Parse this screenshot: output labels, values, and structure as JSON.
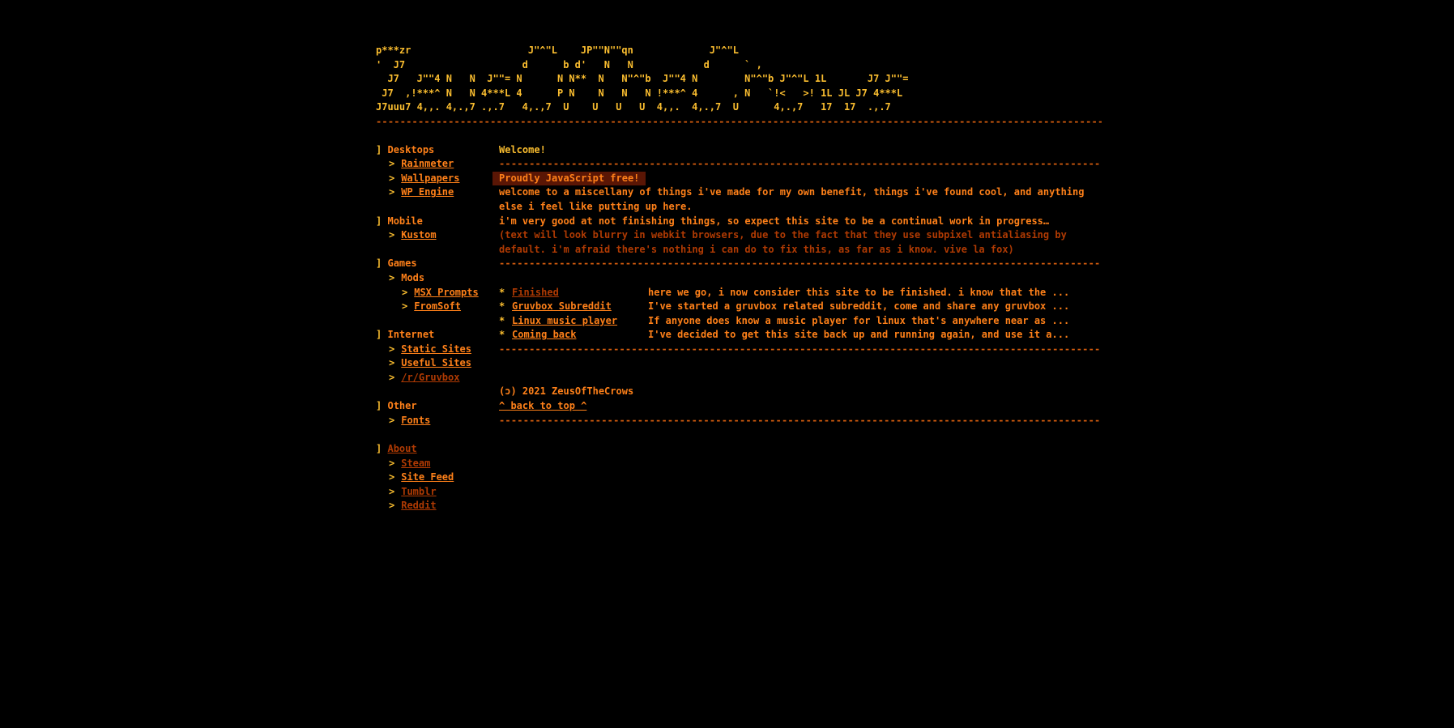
{
  "ascii_logo": "p***zr                    J\"^\"L    JP\"\"N\"\"qn             J\"^\"L\n'  J7                    d      b d'   N   N            d      ` ,\n  J7   J\"\"4 N   N  J\"\"= N      N N**  N   N\"^\"b  J\"\"4 N        N\"^\"b J\"^\"L 1L       J7 J\"\"=\n J7  ,!***^ N   N 4***L 4      P N    N   N   N !***^ 4      , N   `!<   >! 1L JL J7 4***L\nJ7uuu7 4,,. 4,.,7 .,.7   4,.,7  U    U   U   U  4,,.  4,.,7  U      4,.,7   17  17  .,.7",
  "rule": "------------------------------------------------------------------------------------------------------------------------------------------------------------",
  "nav": {
    "desktops": {
      "label": "Desktops",
      "items": [
        "Rainmeter",
        "Wallpapers",
        "WP Engine"
      ]
    },
    "mobile": {
      "label": "Mobile",
      "items": [
        "Kustom"
      ]
    },
    "games": {
      "label": "Games",
      "sub_label": "Mods",
      "sub_items": [
        "MSX Prompts",
        "FromSoft"
      ]
    },
    "internet": {
      "label": "Internet",
      "items": [
        "Static Sites",
        "Useful Sites",
        "/r/Gruvbox"
      ]
    },
    "other": {
      "label": "Other",
      "items": [
        "Fonts"
      ]
    },
    "about": {
      "label": "About",
      "items": [
        "Steam",
        "Site Feed",
        "Tumblr",
        "Reddit"
      ]
    }
  },
  "main": {
    "heading": "Welcome!",
    "badge": "Proudly JavaScript free!",
    "para1": "welcome to a miscellany of things i've made for my own benefit, things i've found cool, and anything else i feel like putting up here.",
    "para2": "i'm very good at not finishing things, so expect this site to be a continual work in progress…",
    "para3": "(text will look blurry in webkit browsers, due to the fact that they use subpixel antialiasing by default. i'm afraid there's nothing i can do to fix this, as far as i know. vive la fox)",
    "posts": [
      {
        "title": "Finished",
        "excerpt": "here we go, i now consider this site to be finished. i know that the ..."
      },
      {
        "title": "Gruvbox Subreddit",
        "excerpt": "I've started a gruvbox related subreddit, come and share any gruvbox ..."
      },
      {
        "title": "Linux music player",
        "excerpt": "If anyone does know a music player for linux that's anywhere near as ..."
      },
      {
        "title": "Coming back",
        "excerpt": "I've decided to get this site back up and running again, and use it a..."
      }
    ],
    "copyright": "(ɔ) 2021 ZeusOfTheCrows",
    "back_to_top": "^ back to top ^"
  },
  "colors": {
    "background": "#000000",
    "orange": "#fe8019",
    "yellow": "#fabd2f",
    "dim": "#af3a03",
    "rule": "#d65d0e",
    "badge_bg": "#5a1605"
  }
}
